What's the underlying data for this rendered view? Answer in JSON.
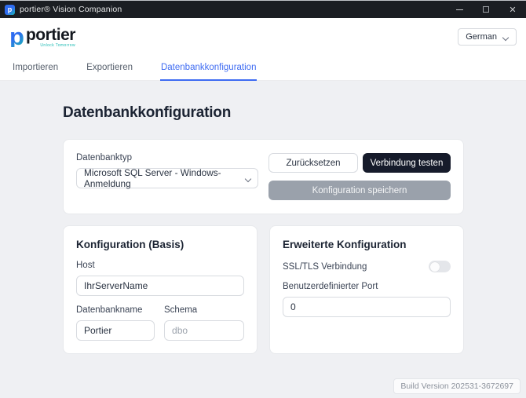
{
  "window": {
    "title": "portier® Vision Companion",
    "controls": {
      "close": "✕"
    }
  },
  "brand": {
    "mark": "p",
    "name": "portier",
    "tagline": "Unlock Tomorrow"
  },
  "language": {
    "selected": "German"
  },
  "tabs": [
    {
      "label": "Importieren"
    },
    {
      "label": "Exportieren"
    },
    {
      "label": "Datenbankkonfiguration"
    }
  ],
  "page": {
    "title": "Datenbankkonfiguration"
  },
  "db_card": {
    "type_label": "Datenbanktyp",
    "type_value": "Microsoft SQL Server - Windows-Anmeldung",
    "reset_label": "Zurücksetzen",
    "test_label": "Verbindung testen",
    "save_label": "Konfiguration speichern"
  },
  "basis_card": {
    "title": "Konfiguration (Basis)",
    "host_label": "Host",
    "host_value": "IhrServerName",
    "dbname_label": "Datenbankname",
    "dbname_value": "Portier",
    "schema_label": "Schema",
    "schema_placeholder": "dbo"
  },
  "advanced_card": {
    "title": "Erweiterte Konfiguration",
    "ssl_label": "SSL/TLS Verbindung",
    "ssl_state": "off",
    "port_label": "Benutzerdefinierter Port",
    "port_value": "0"
  },
  "footer": {
    "build": "Build Version 202531-3672697"
  },
  "colors": {
    "accent_blue": "#3e6bf2",
    "brand_teal": "#19b9b2",
    "dark_button": "#161b2b",
    "disabled_button": "#9aa1ab",
    "titlebar": "#1b1e23"
  }
}
